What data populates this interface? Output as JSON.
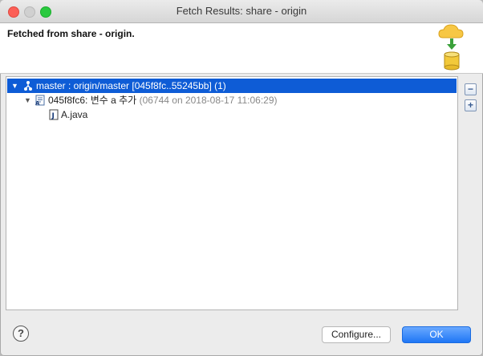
{
  "window": {
    "title": "Fetch Results: share - origin"
  },
  "header": {
    "message": "Fetched from share - origin.",
    "icon": "fetch-cloud-database-icon"
  },
  "tree": {
    "branch": {
      "label": "master : origin/master [045f8fc..55245bb] (1)",
      "icon": "branch-icon",
      "expanded": true,
      "selected": true
    },
    "commit": {
      "hash": "045f8fc6:",
      "message": "변수 a 추가",
      "meta": "(06744 on 2018-08-17 11:06:29)",
      "icon": "commit-icon",
      "expanded": true
    },
    "file": {
      "label": "A.java",
      "icon": "java-file-icon"
    }
  },
  "side_buttons": {
    "collapse": "collapse-all-icon",
    "expand": "expand-all-icon"
  },
  "footer": {
    "help": "?",
    "configure_label": "Configure...",
    "ok_label": "OK"
  },
  "colors": {
    "selection": "#0e5cd6",
    "ok_button": "#1f76f5"
  }
}
